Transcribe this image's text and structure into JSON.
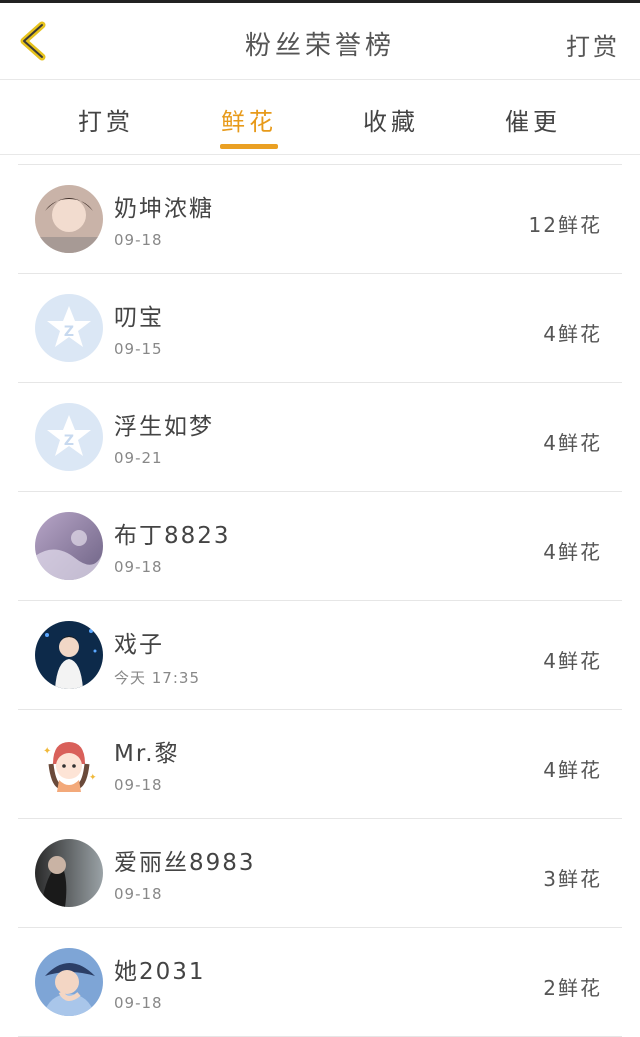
{
  "header": {
    "title": "粉丝荣誉榜",
    "right_link": "打赏"
  },
  "tabs": [
    {
      "label": "打赏"
    },
    {
      "label": "鲜花"
    },
    {
      "label": "收藏"
    },
    {
      "label": "催更"
    }
  ],
  "active_tab": "鲜花",
  "colors": {
    "accent": "#eaa023",
    "back_icon": "#e6c21c",
    "default_avatar": "#dbe7f5"
  },
  "fans": [
    {
      "name": "奶坤浓糖",
      "date": "09-18",
      "count": "12鲜花",
      "avatar": "photo-avatar"
    },
    {
      "name": "叨宝",
      "date": "09-15",
      "count": "4鲜花",
      "avatar": "default-star-avatar"
    },
    {
      "name": "浮生如梦",
      "date": "09-21",
      "count": "4鲜花",
      "avatar": "default-star-avatar"
    },
    {
      "name": "布丁8823",
      "date": "09-18",
      "count": "4鲜花",
      "avatar": "photo-avatar"
    },
    {
      "name": "戏子",
      "date": "今天 17:35",
      "count": "4鲜花",
      "avatar": "photo-avatar"
    },
    {
      "name": "Mr.黎",
      "date": "09-18",
      "count": "4鲜花",
      "avatar": "cartoon-avatar"
    },
    {
      "name": "爱丽丝8983",
      "date": "09-18",
      "count": "3鲜花",
      "avatar": "photo-avatar"
    },
    {
      "name": "她2031",
      "date": "09-18",
      "count": "2鲜花",
      "avatar": "photo-avatar"
    }
  ]
}
